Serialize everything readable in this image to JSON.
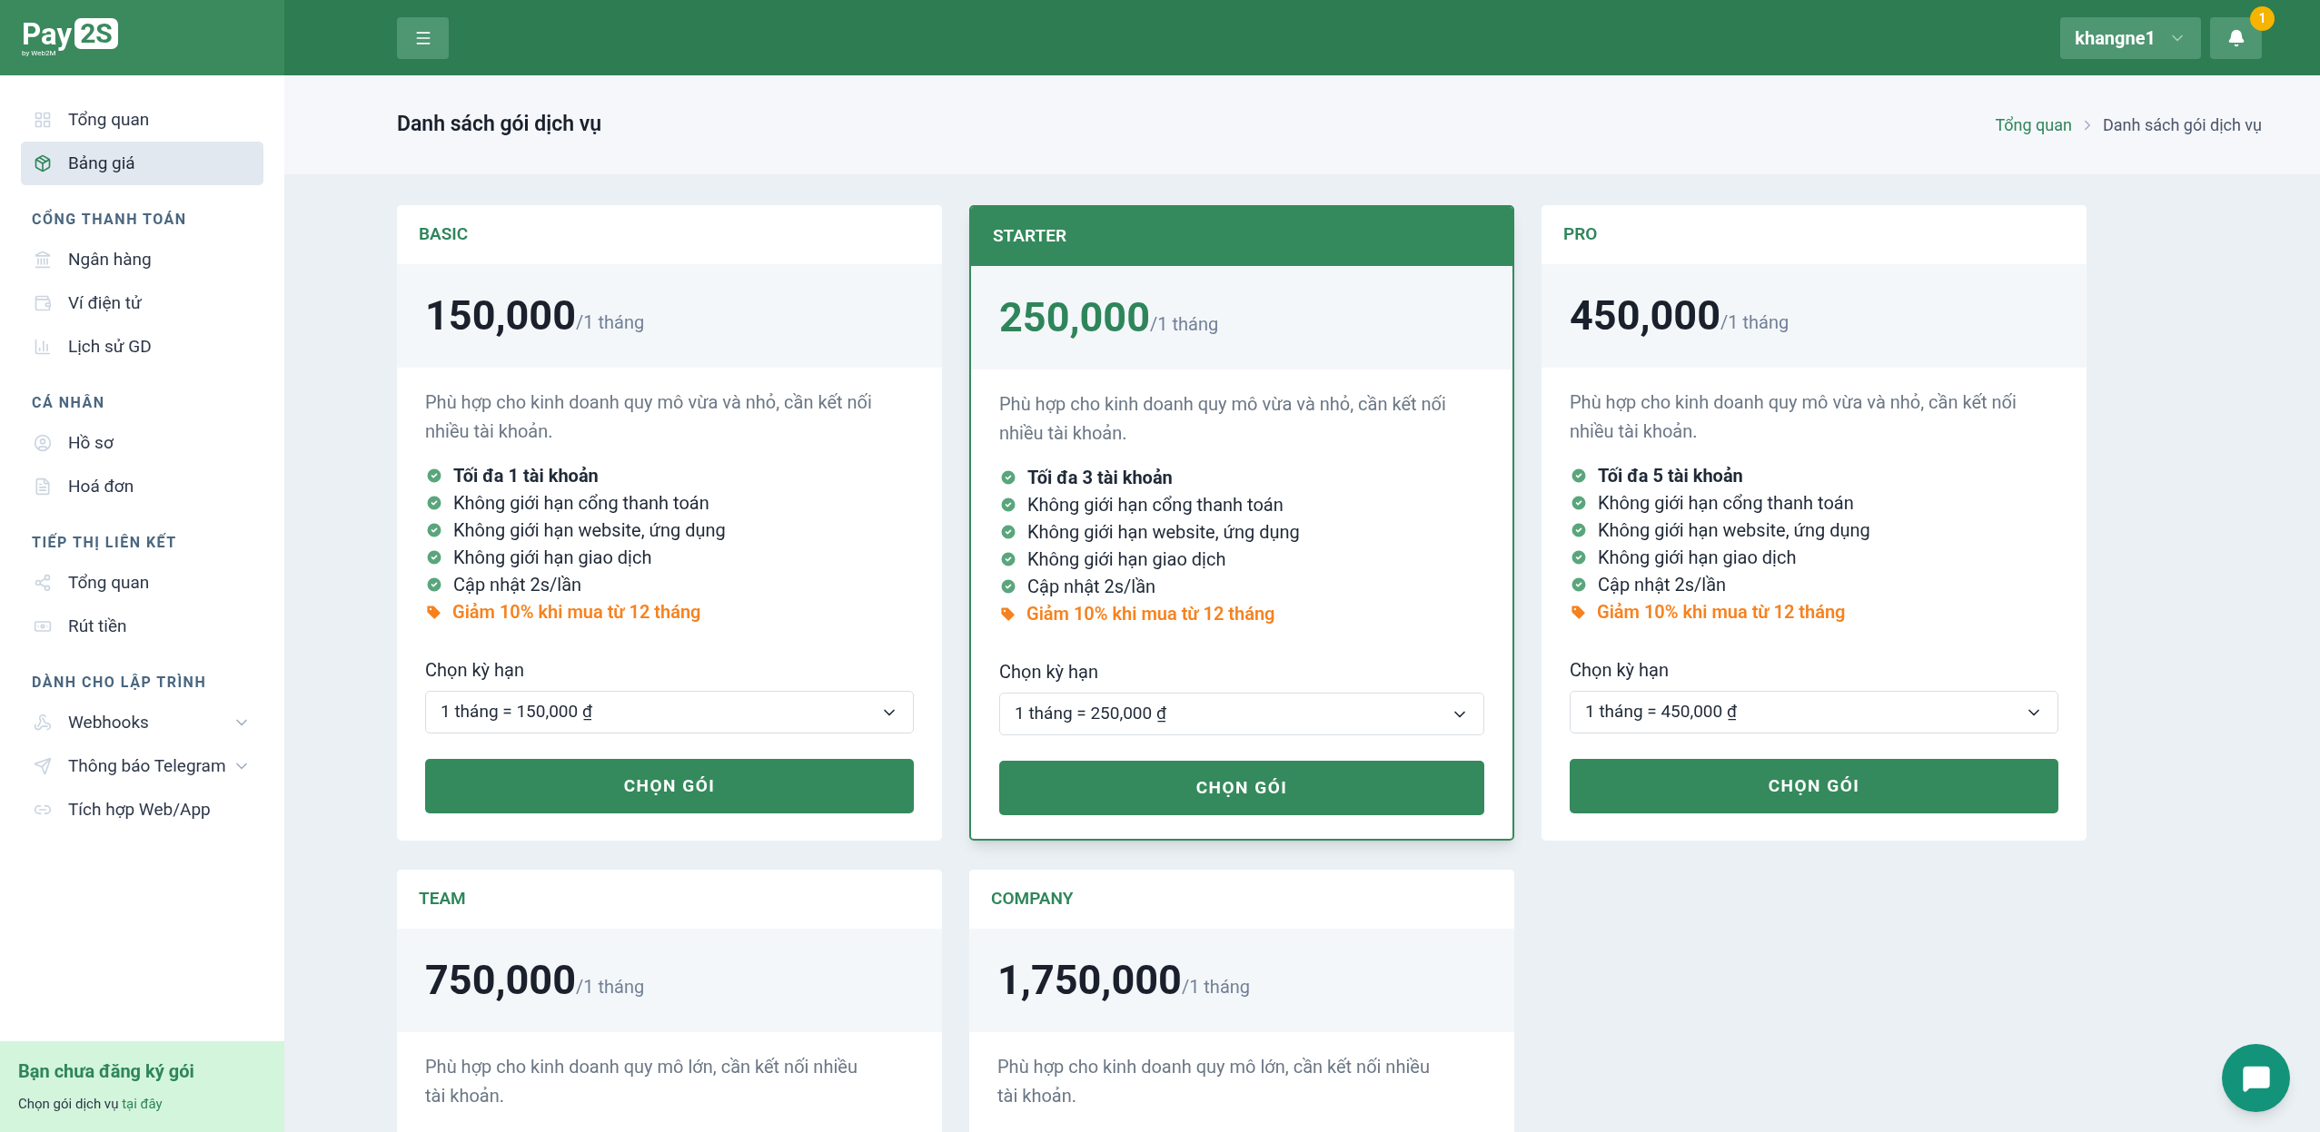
{
  "brand": {
    "name": "Pay",
    "badge": "2S",
    "tagline": "by Web2M"
  },
  "sidebar": {
    "sections": [
      {
        "items": [
          {
            "label": "Tổng quan",
            "selected": false
          },
          {
            "label": "Bảng giá",
            "selected": true
          }
        ]
      },
      {
        "heading": "CỔNG THANH TOÁN",
        "items": [
          {
            "label": "Ngân hàng",
            "selected": false
          },
          {
            "label": "Ví điện tử",
            "selected": false
          },
          {
            "label": "Lịch sử GD",
            "selected": false
          }
        ]
      },
      {
        "heading": "CÁ NHÂN",
        "items": [
          {
            "label": "Hồ sơ",
            "selected": false
          },
          {
            "label": "Hoá đơn",
            "selected": false
          }
        ]
      },
      {
        "heading": "TIẾP THỊ LIÊN KẾT",
        "items": [
          {
            "label": "Tổng quan",
            "selected": false
          },
          {
            "label": "Rút tiền",
            "selected": false
          }
        ]
      },
      {
        "heading": "DÀNH CHO LẬP TRÌNH",
        "items": [
          {
            "label": "Webhooks",
            "selected": false,
            "expanded": false
          },
          {
            "label": "Thông báo Telegram",
            "selected": false,
            "expanded": false
          },
          {
            "label": "Tích hợp Web/App",
            "selected": false
          }
        ]
      }
    ],
    "notice": {
      "title": "Bạn chưa đăng ký gói",
      "text": "Chọn gói dịch vụ",
      "link": "tại đây"
    }
  },
  "header": {
    "user": "khangne1",
    "notifications": "1"
  },
  "page": {
    "title": "Danh sách gói dịch vụ",
    "breadcrumb": [
      "Tổng quan",
      "Danh sách gói dịch vụ"
    ]
  },
  "plans": [
    {
      "name": "BASIC",
      "selected": false,
      "price": "150,000",
      "period": "/1 tháng",
      "description": "Phù hợp cho kinh doanh quy mô vừa và nhỏ, cần kết nối nhiều tài khoản.",
      "features": [
        {
          "text": "Tối đa 1 tài khoản",
          "bold": true
        },
        {
          "text": "Không giới hạn cổng thanh toán",
          "bold": false
        },
        {
          "text": "Không giới hạn website, ứng dụng",
          "bold": false
        },
        {
          "text": "Không giới hạn giao dịch",
          "bold": false
        },
        {
          "text": "Cập nhật 2s/lần",
          "bold": false
        }
      ],
      "promo": "Giảm 10% khi mua từ 12 tháng",
      "term_label": "Chọn kỳ hạn",
      "term_value": "1 tháng = 150,000 ₫",
      "button": "CHỌN GÓI"
    },
    {
      "name": "STARTER",
      "selected": true,
      "price": "250,000",
      "period": "/1 tháng",
      "description": "Phù hợp cho kinh doanh quy mô vừa và nhỏ, cần kết nối nhiều tài khoản.",
      "features": [
        {
          "text": "Tối đa 3 tài khoản",
          "bold": true
        },
        {
          "text": "Không giới hạn cổng thanh toán",
          "bold": false
        },
        {
          "text": "Không giới hạn website, ứng dụng",
          "bold": false
        },
        {
          "text": "Không giới hạn giao dịch",
          "bold": false
        },
        {
          "text": "Cập nhật 2s/lần",
          "bold": false
        }
      ],
      "promo": "Giảm 10% khi mua từ 12 tháng",
      "term_label": "Chọn kỳ hạn",
      "term_value": "1 tháng = 250,000 ₫",
      "button": "CHỌN GÓI"
    },
    {
      "name": "PRO",
      "selected": false,
      "price": "450,000",
      "period": "/1 tháng",
      "description": "Phù hợp cho kinh doanh quy mô vừa và nhỏ, cần kết nối nhiều tài khoản.",
      "features": [
        {
          "text": "Tối đa 5 tài khoản",
          "bold": true
        },
        {
          "text": "Không giới hạn cổng thanh toán",
          "bold": false
        },
        {
          "text": "Không giới hạn website, ứng dụng",
          "bold": false
        },
        {
          "text": "Không giới hạn giao dịch",
          "bold": false
        },
        {
          "text": "Cập nhật 2s/lần",
          "bold": false
        }
      ],
      "promo": "Giảm 10% khi mua từ 12 tháng",
      "term_label": "Chọn kỳ hạn",
      "term_value": "1 tháng = 450,000 ₫",
      "button": "CHỌN GÓI"
    },
    {
      "name": "TEAM",
      "selected": false,
      "price": "750,000",
      "period": "/1 tháng",
      "description": "Phù hợp cho kinh doanh quy mô lớn, cần kết nối nhiều tài khoản."
    },
    {
      "name": "COMPANY",
      "selected": false,
      "price": "1,750,000",
      "period": "/1 tháng",
      "description": "Phù hợp cho kinh doanh quy mô lớn, cần kết nối nhiều tài khoản."
    }
  ]
}
